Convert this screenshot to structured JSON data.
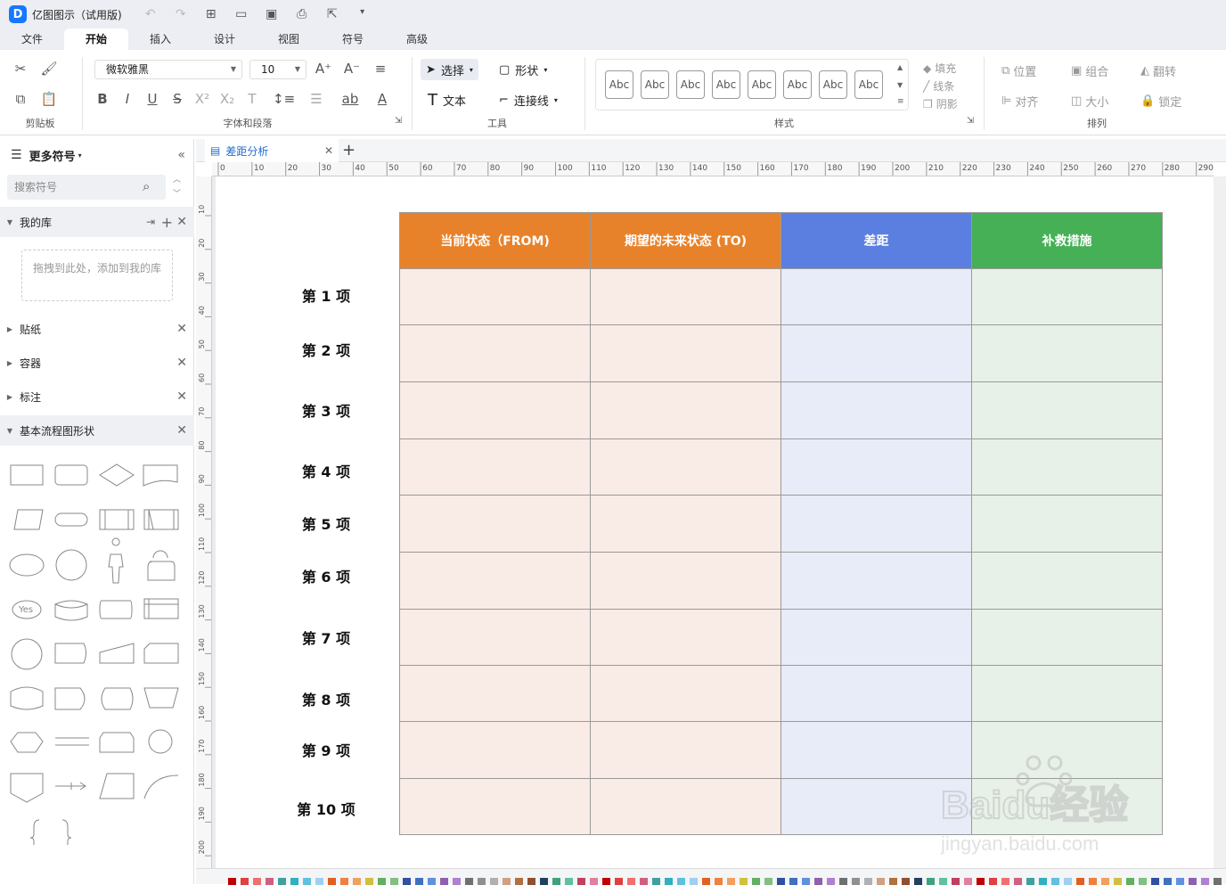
{
  "app": {
    "title": "亿图图示（试用版)",
    "logo_icon": "edraw-logo-icon"
  },
  "menu": {
    "tabs": [
      "文件",
      "开始",
      "插入",
      "设计",
      "视图",
      "符号",
      "高级"
    ],
    "active": "开始"
  },
  "ribbon": {
    "groups": {
      "clipboard": "剪贴板",
      "font": "字体和段落",
      "tools": "工具",
      "style": "样式",
      "arrange": "排列"
    },
    "font_name": "微软雅黑",
    "font_size": "10",
    "select": "选择",
    "shape": "形状",
    "text": "文本",
    "connector": "连接线",
    "style_sample": "Abc",
    "fill": "填充",
    "line": "线条",
    "shadow": "阴影",
    "position": "位置",
    "group": "组合",
    "rotate": "翻转",
    "align": "对齐",
    "size": "大小",
    "lock": "锁定"
  },
  "sidebar": {
    "title": "更多符号",
    "search_placeholder": "搜索符号",
    "my_library": "我的库",
    "dropzone": "拖拽到此处，添加到我的库",
    "sections": [
      "贴纸",
      "容器",
      "标注",
      "基本流程图形状"
    ],
    "shape_yes": "Yes"
  },
  "document": {
    "tab": "差距分析"
  },
  "ruler": {
    "h_ticks": [
      "0",
      "10",
      "20",
      "30",
      "40",
      "50",
      "60",
      "70",
      "80",
      "90",
      "100",
      "110",
      "120",
      "130",
      "140",
      "150",
      "160",
      "170",
      "180",
      "190",
      "200",
      "210",
      "220",
      "230",
      "240",
      "250",
      "260",
      "270",
      "280",
      "290"
    ],
    "v_ticks": [
      "10",
      "20",
      "30",
      "40",
      "50",
      "60",
      "70",
      "80",
      "90",
      "100",
      "110",
      "120",
      "130",
      "140",
      "150",
      "160",
      "170",
      "180",
      "190",
      "200"
    ]
  },
  "table": {
    "headers": [
      {
        "label": "当前状态（FROM)",
        "color": "#e8822a"
      },
      {
        "label": "期望的未来状态 (TO)",
        "color": "#e8822a"
      },
      {
        "label": "差距",
        "color": "#5b7fe0"
      },
      {
        "label": "补救措施",
        "color": "#45b055"
      }
    ],
    "cell_colors": [
      "#f9ebe6",
      "#f9ebe6",
      "#e8ecf8",
      "#e8f1e8"
    ],
    "rows": [
      "第 1 项",
      "第 2 项",
      "第 3 项",
      "第 4 项",
      "第 5 项",
      "第 6 项",
      "第 7 项",
      "第 8 项",
      "第 9 项",
      "第 10 项"
    ]
  },
  "watermark": {
    "brand": "Baidu经验",
    "url": "jingyan.baidu.com"
  }
}
